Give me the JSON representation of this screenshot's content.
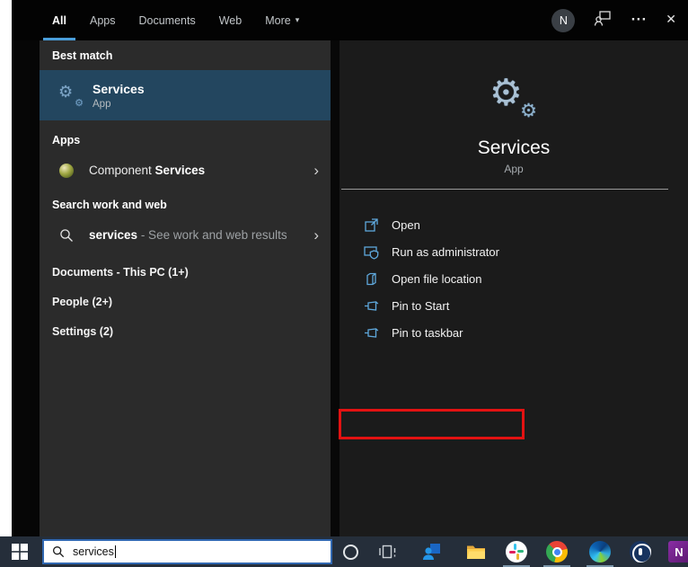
{
  "glyphs": {
    "gear": "⚙",
    "chevron": "›",
    "dropdown": "▾",
    "close": "✕",
    "ellipsis": "···"
  },
  "colors": {
    "accent": "#4a9eda",
    "best_match_bg": "#23465f",
    "highlight_red": "#e31212"
  },
  "header": {
    "tabs": [
      {
        "label": "All",
        "active": true
      },
      {
        "label": "Apps"
      },
      {
        "label": "Documents"
      },
      {
        "label": "Web"
      },
      {
        "label": "More"
      }
    ],
    "avatar_letter": "N"
  },
  "results": {
    "best_match_header": "Best match",
    "best_match": {
      "title": "Services",
      "subtitle": "App"
    },
    "apps_header": "Apps",
    "app_item": {
      "prefix": "Component ",
      "match": "Services"
    },
    "search_header": "Search work and web",
    "search_item": {
      "term": "services",
      "rest": " - See work and web results"
    },
    "groups": [
      {
        "label": "Documents - This PC (1+)"
      },
      {
        "label": "People (2+)"
      },
      {
        "label": "Settings (2)"
      }
    ]
  },
  "preview": {
    "title": "Services",
    "subtitle": "App",
    "actions": [
      {
        "label": "Open"
      },
      {
        "label": "Run as administrator",
        "highlighted": true
      },
      {
        "label": "Open file location"
      },
      {
        "label": "Pin to Start"
      },
      {
        "label": "Pin to taskbar"
      }
    ]
  },
  "taskbar": {
    "search_value": "services",
    "icons": [
      "cortana",
      "task-view",
      "people",
      "file-explorer",
      "slack",
      "chrome",
      "edge",
      "1password",
      "onenote"
    ]
  }
}
